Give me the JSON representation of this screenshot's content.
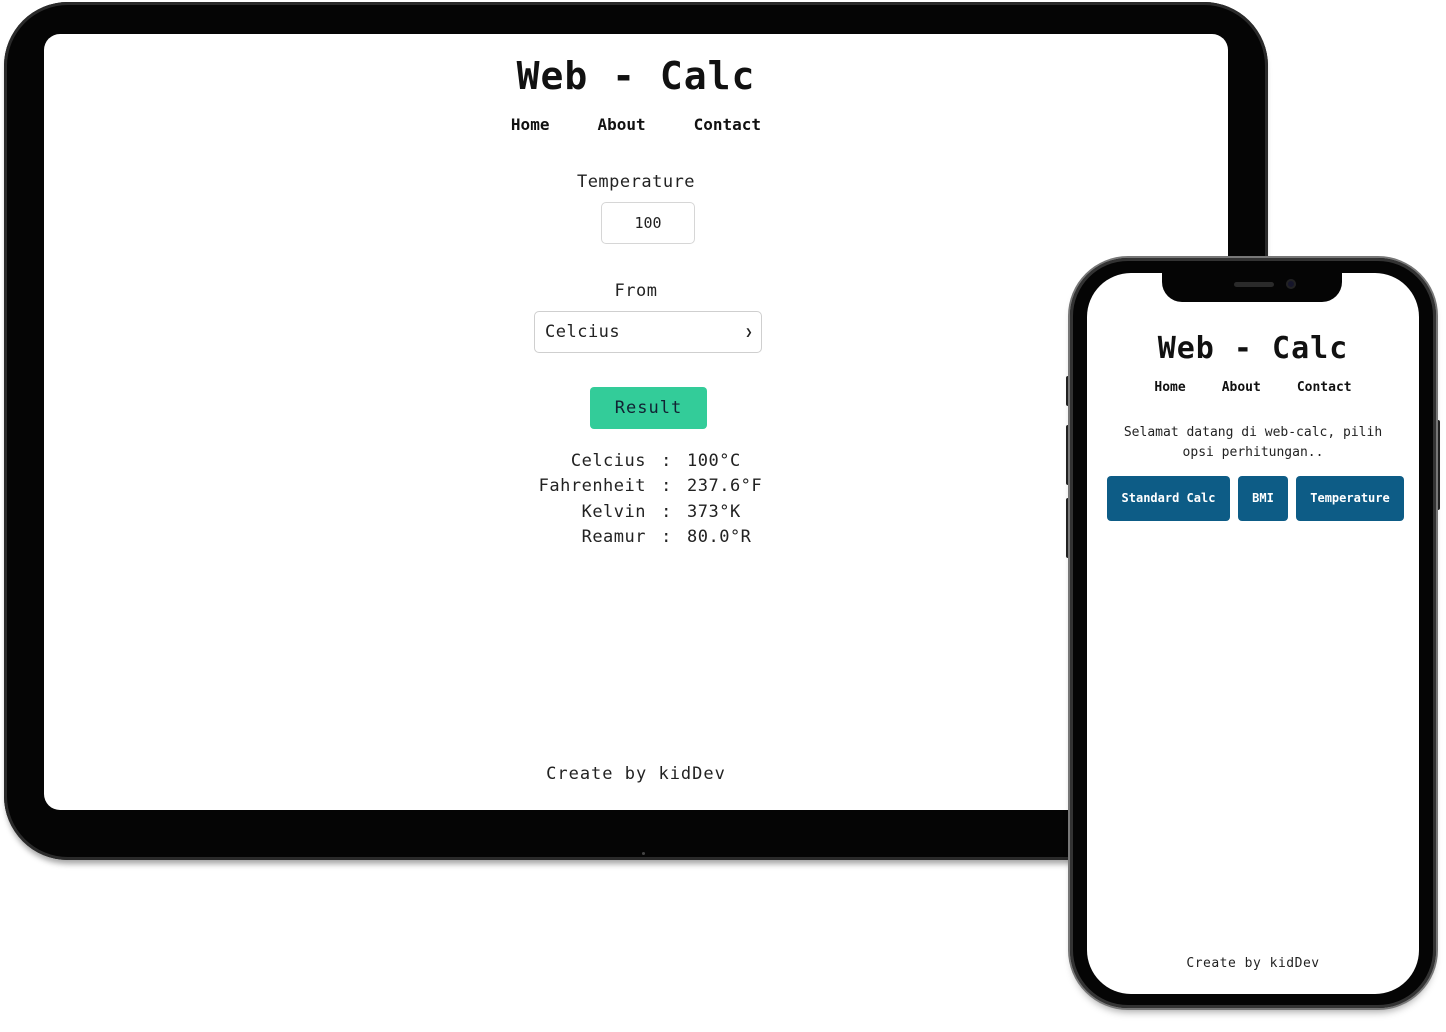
{
  "tablet": {
    "title": "Web - Calc",
    "nav": [
      "Home",
      "About",
      "Contact"
    ],
    "temperature_label": "Temperature",
    "temperature_value": "100",
    "from_label": "From",
    "from_selected": "Celcius",
    "result_button": "Result",
    "results": [
      {
        "label": "Celcius",
        "value": "100°C"
      },
      {
        "label": "Fahrenheit",
        "value": "237.6°F"
      },
      {
        "label": "Kelvin",
        "value": "373°K"
      },
      {
        "label": "Reamur",
        "value": "80.0°R"
      }
    ],
    "separator": ":",
    "footer": "Create by kidDev",
    "accent_color": "#33cc99"
  },
  "phone": {
    "title": "Web - Calc",
    "nav": [
      "Home",
      "About",
      "Contact"
    ],
    "intro": "Selamat datang di web-calc, pilih opsi perhitungan..",
    "buttons": [
      "Standard Calc",
      "BMI",
      "Temperature"
    ],
    "footer": "Create by kidDev",
    "button_color": "#0d5c86"
  }
}
